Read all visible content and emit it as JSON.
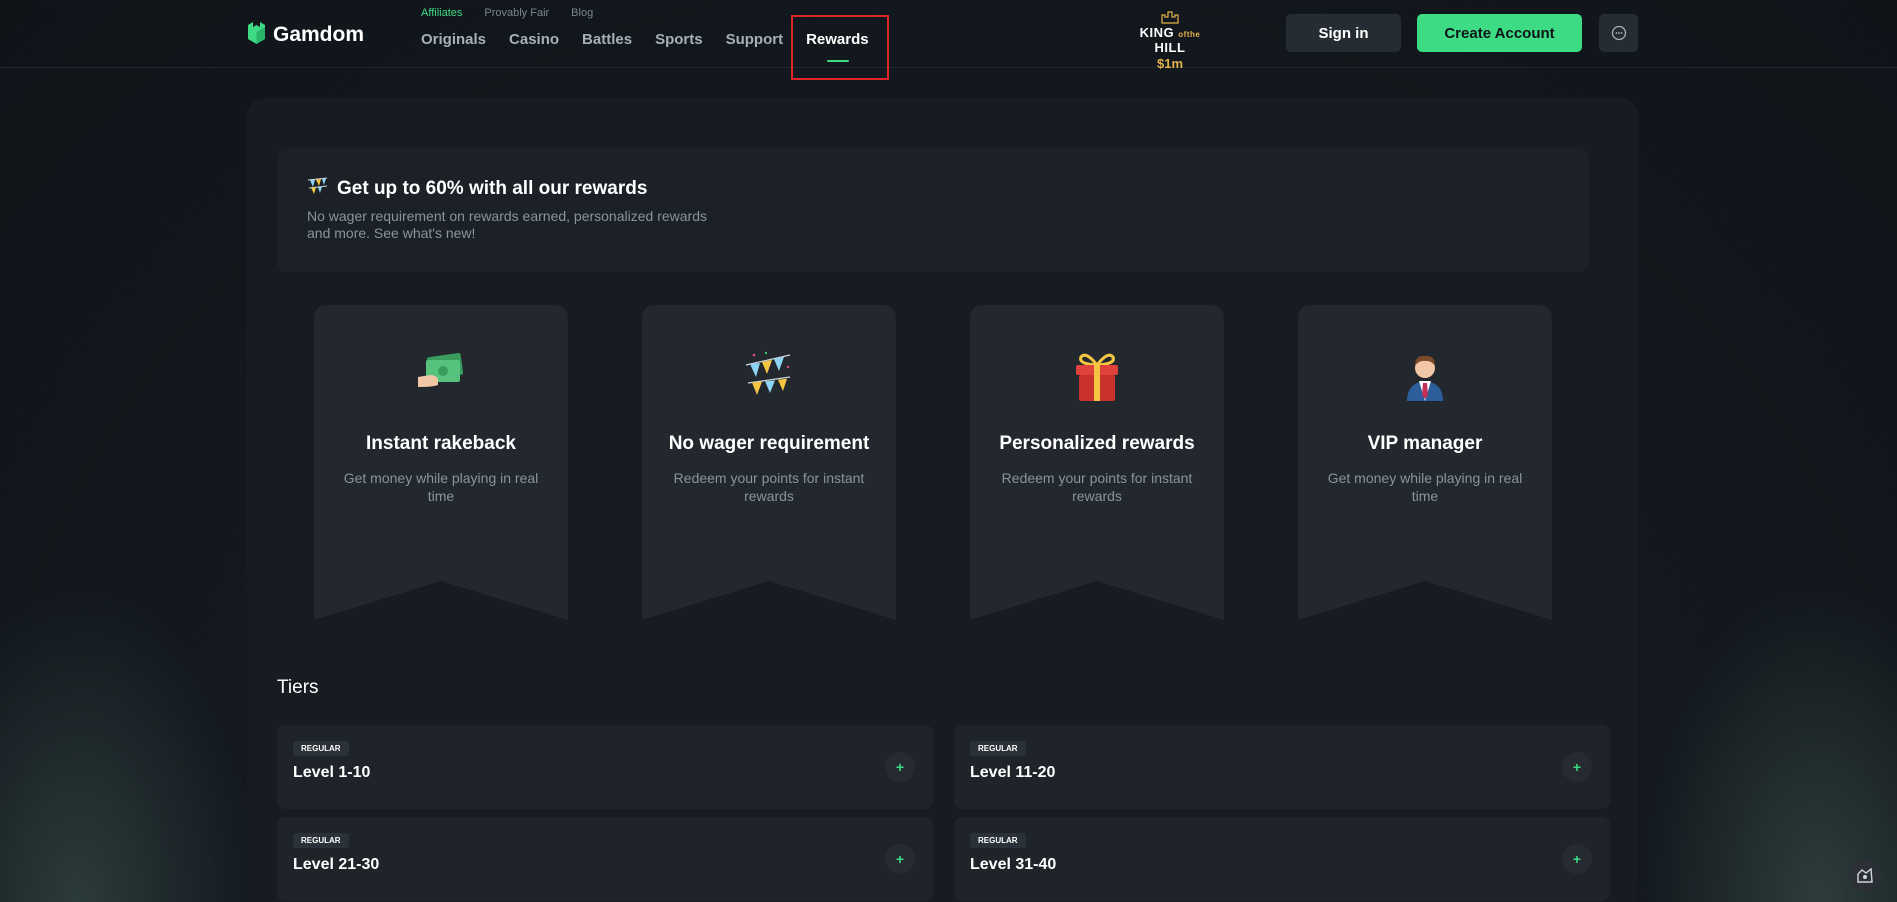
{
  "header": {
    "brand": "Gamdom",
    "top_links": [
      "Affiliates",
      "Provably Fair",
      "Blog"
    ],
    "nav": [
      "Originals",
      "Casino",
      "Battles",
      "Sports",
      "Support",
      "Rewards"
    ],
    "active_nav": "Rewards",
    "koth": {
      "line1_a": "KING",
      "line1_of": "of",
      "line1_the": "the",
      "line1_b": "HILL",
      "prize": "$1m"
    },
    "sign_in": "Sign in",
    "create_account": "Create Account"
  },
  "promo": {
    "title": "Get up to 60% with all our rewards",
    "subtitle": "No wager requirement on rewards earned, personalized rewards and more. See what's new!"
  },
  "cards": [
    {
      "title": "Instant rakeback",
      "desc": "Get money while playing in real time",
      "icon": "cash-hand-icon"
    },
    {
      "title": "No wager requirement",
      "desc": "Redeem your points for instant rewards",
      "icon": "bunting-icon"
    },
    {
      "title": "Personalized rewards",
      "desc": "Redeem your points for instant rewards",
      "icon": "gift-icon"
    },
    {
      "title": "VIP manager",
      "desc": "Get money while playing in real time",
      "icon": "manager-icon"
    }
  ],
  "tiers_heading": "Tiers",
  "tiers": [
    {
      "badge": "REGULAR",
      "name": "Level 1-10"
    },
    {
      "badge": "REGULAR",
      "name": "Level 11-20"
    },
    {
      "badge": "REGULAR",
      "name": "Level 21-30"
    },
    {
      "badge": "REGULAR",
      "name": "Level 31-40"
    }
  ],
  "colors": {
    "accent": "#3ddc84",
    "panel": "#161c22",
    "card": "#22282e",
    "highlight": "#e0242a"
  }
}
